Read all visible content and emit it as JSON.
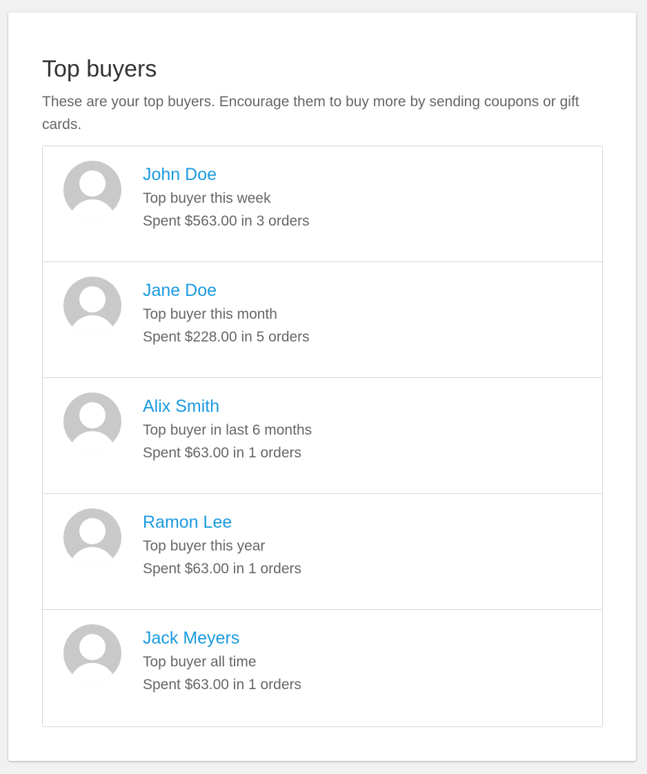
{
  "panel": {
    "title": "Top buyers",
    "description": "These are your top buyers. Encourage them to buy more by sending coupons or gift cards."
  },
  "buyers": [
    {
      "name": "John Doe",
      "period": "Top buyer this week",
      "spent": "Spent $563.00 in 3 orders"
    },
    {
      "name": "Jane Doe",
      "period": "Top buyer this month",
      "spent": "Spent $228.00 in 5 orders"
    },
    {
      "name": "Alix Smith",
      "period": "Top buyer in last 6 months",
      "spent": "Spent $63.00 in 1 orders"
    },
    {
      "name": "Ramon Lee",
      "period": "Top buyer this year",
      "spent": "Spent $63.00 in 1 orders"
    },
    {
      "name": "Jack Meyers",
      "period": "Top buyer all time",
      "spent": "Spent $63.00 in 1 orders"
    }
  ],
  "icons": {
    "avatar": "user-avatar-placeholder-icon"
  },
  "colors": {
    "link": "#1a9ae0",
    "text": "#666666",
    "heading": "#333333",
    "avatar": "#c9c9c9"
  }
}
